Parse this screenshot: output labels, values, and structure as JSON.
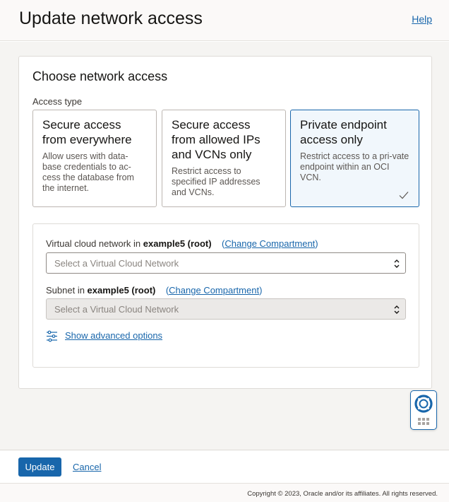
{
  "header": {
    "title": "Update network access",
    "help_label": "Help"
  },
  "panel": {
    "title": "Choose network access",
    "access_type_label": "Access type",
    "cards": [
      {
        "title": "Secure access from everywhere",
        "description": "Allow users with data-base credentials to ac-cess the database from the internet.",
        "selected": false
      },
      {
        "title": "Secure access from allowed IPs and VCNs only",
        "description": "Restrict access to specified IP addresses and VCNs.",
        "selected": false
      },
      {
        "title": "Private endpoint access only",
        "description": "Restrict access to a pri-vate endpoint within an OCI VCN.",
        "selected": true
      }
    ],
    "vcn": {
      "label_prefix": "Virtual cloud network in ",
      "compartment": "example5 (root)",
      "change_label": "Change Compartment",
      "placeholder": "Select a Virtual Cloud Network"
    },
    "subnet": {
      "label_prefix": "Subnet in ",
      "compartment": "example5 (root)",
      "change_label": "Change Compartment",
      "placeholder": "Select a Virtual Cloud Network",
      "disabled": true
    },
    "advanced_label": "Show advanced options"
  },
  "footer": {
    "update_label": "Update",
    "cancel_label": "Cancel"
  },
  "copyright": "Copyright © 2023, Oracle and/or its affiliates. All rights reserved.",
  "colors": {
    "accent": "#1866ab",
    "selected_card_bg": "#f1f7fc"
  }
}
